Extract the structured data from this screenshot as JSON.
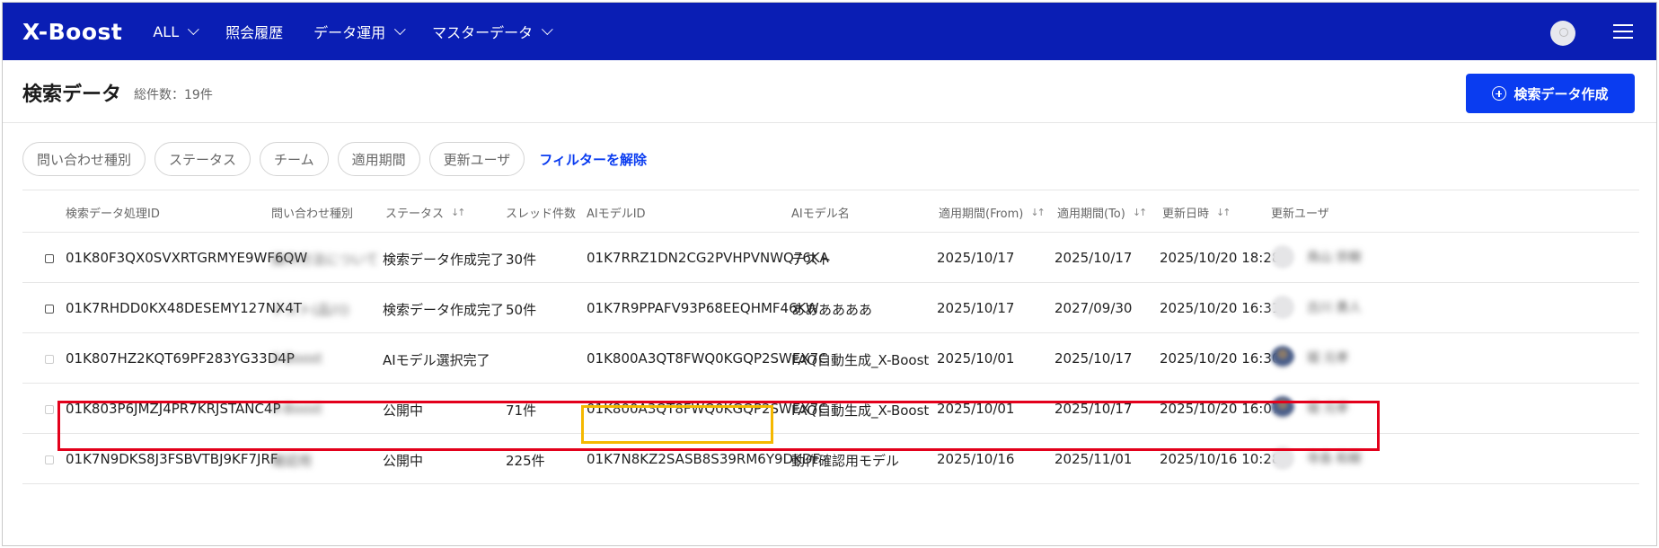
{
  "header": {
    "logo": "X-Boost",
    "nav": [
      {
        "label": "ALL",
        "dropdown": true
      },
      {
        "label": "照会履歴",
        "dropdown": false
      },
      {
        "label": "データ運用",
        "dropdown": true
      },
      {
        "label": "マスターデータ",
        "dropdown": true
      }
    ],
    "brand_color": "#0a1eb4"
  },
  "page": {
    "title": "検索データ",
    "total": "総件数：19件",
    "create_button": "検索データ作成"
  },
  "filters": {
    "chips": [
      "問い合わせ種別",
      "ステータス",
      "チーム",
      "適用期間",
      "更新ユーザ"
    ],
    "clear": "フィルターを解除"
  },
  "table": {
    "columns": [
      "検索データ処理ID",
      "問い合わせ種別",
      "ステータス",
      "スレッド件数",
      "AIモデルID",
      "AIモデル名",
      "適用期間(From)",
      "適用期間(To)",
      "更新日時",
      "更新ユーザ"
    ],
    "rows": [
      {
        "id": "01K80F3QX0SVXRTGRMYE9WF6QW",
        "inquiry": "操作方法について",
        "status": "検索データ作成完了",
        "threads": "30件",
        "model_id": "01K7RRZ1DN2CG2PVHPVNWQ76KA",
        "model_name": "テスト",
        "from": "2025/10/17",
        "to": "2025/10/17",
        "updated": "2025/10/20 18:28",
        "user": "鳥山 宗樹",
        "checkbox_enabled": true
      },
      {
        "id": "01K7RHDD0KX48DESEMY127NX4T",
        "inquiry": "テスト(品川)",
        "status": "検索データ作成完了",
        "threads": "50件",
        "model_id": "01K7R9PPAFV93P68EEQHMF46KW",
        "model_name": "ああああああ",
        "from": "2025/10/17",
        "to": "2027/09/30",
        "updated": "2025/10/20 16:31",
        "user": "古川 勇人",
        "checkbox_enabled": true
      },
      {
        "id": "01K807HZ2KQT69PF283YG33D4P",
        "inquiry": "X-Boost",
        "status": "AIモデル選択完了",
        "threads": "",
        "model_id": "01K800A3QT8FWQ0KGQP2SWEX7C",
        "model_name": "FAQ自動生成_X-Boost",
        "from": "2025/10/01",
        "to": "2025/10/17",
        "updated": "2025/10/20 16:30",
        "user": "堀 元孝",
        "checkbox_enabled": false
      },
      {
        "id": "01K803P6JMZJ4PR7KRJSTANC4P",
        "inquiry": "X-Boost",
        "status": "公開中",
        "threads": "71件",
        "model_id": "01K800A3QT8FWQ0KGQP2SWEX7C",
        "model_name": "FAQ自動生成_X-Boost",
        "from": "2025/10/01",
        "to": "2025/10/17",
        "updated": "2025/10/20 16:07",
        "user": "堀 元孝",
        "checkbox_enabled": false
      },
      {
        "id": "01K7N9DKS8J3FSBVTBJ9KF7JRF",
        "inquiry": "確認用",
        "status": "公開中",
        "threads": "225件",
        "model_id": "01K7N8KZ2SASB8S39RM6Y9DKDF",
        "model_name": "動作確認用モデル",
        "from": "2025/10/16",
        "to": "2025/11/01",
        "updated": "2025/10/16 10:28",
        "user": "寺島 和樹",
        "checkbox_enabled": false
      }
    ]
  },
  "colors": {
    "primary_button": "#0a3cf0",
    "highlight_row": "#e3001b",
    "highlight_cell": "#f5b800"
  }
}
